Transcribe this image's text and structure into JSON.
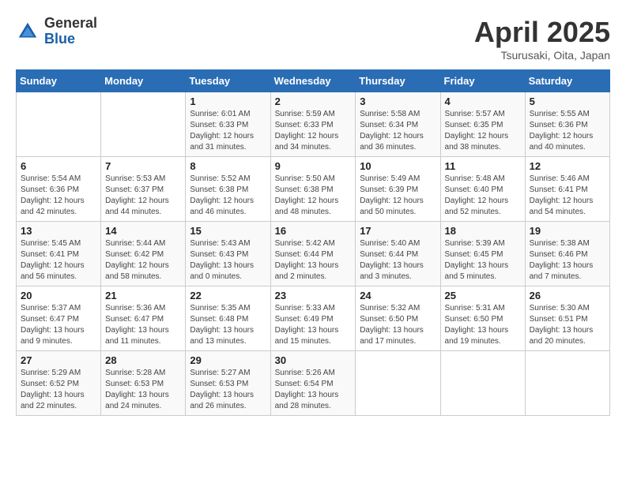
{
  "header": {
    "logo_general": "General",
    "logo_blue": "Blue",
    "title": "April 2025",
    "subtitle": "Tsurusaki, Oita, Japan"
  },
  "weekdays": [
    "Sunday",
    "Monday",
    "Tuesday",
    "Wednesday",
    "Thursday",
    "Friday",
    "Saturday"
  ],
  "weeks": [
    [
      {
        "day": "",
        "sunrise": "",
        "sunset": "",
        "daylight": ""
      },
      {
        "day": "",
        "sunrise": "",
        "sunset": "",
        "daylight": ""
      },
      {
        "day": "1",
        "sunrise": "Sunrise: 6:01 AM",
        "sunset": "Sunset: 6:33 PM",
        "daylight": "Daylight: 12 hours and 31 minutes."
      },
      {
        "day": "2",
        "sunrise": "Sunrise: 5:59 AM",
        "sunset": "Sunset: 6:33 PM",
        "daylight": "Daylight: 12 hours and 34 minutes."
      },
      {
        "day": "3",
        "sunrise": "Sunrise: 5:58 AM",
        "sunset": "Sunset: 6:34 PM",
        "daylight": "Daylight: 12 hours and 36 minutes."
      },
      {
        "day": "4",
        "sunrise": "Sunrise: 5:57 AM",
        "sunset": "Sunset: 6:35 PM",
        "daylight": "Daylight: 12 hours and 38 minutes."
      },
      {
        "day": "5",
        "sunrise": "Sunrise: 5:55 AM",
        "sunset": "Sunset: 6:36 PM",
        "daylight": "Daylight: 12 hours and 40 minutes."
      }
    ],
    [
      {
        "day": "6",
        "sunrise": "Sunrise: 5:54 AM",
        "sunset": "Sunset: 6:36 PM",
        "daylight": "Daylight: 12 hours and 42 minutes."
      },
      {
        "day": "7",
        "sunrise": "Sunrise: 5:53 AM",
        "sunset": "Sunset: 6:37 PM",
        "daylight": "Daylight: 12 hours and 44 minutes."
      },
      {
        "day": "8",
        "sunrise": "Sunrise: 5:52 AM",
        "sunset": "Sunset: 6:38 PM",
        "daylight": "Daylight: 12 hours and 46 minutes."
      },
      {
        "day": "9",
        "sunrise": "Sunrise: 5:50 AM",
        "sunset": "Sunset: 6:38 PM",
        "daylight": "Daylight: 12 hours and 48 minutes."
      },
      {
        "day": "10",
        "sunrise": "Sunrise: 5:49 AM",
        "sunset": "Sunset: 6:39 PM",
        "daylight": "Daylight: 12 hours and 50 minutes."
      },
      {
        "day": "11",
        "sunrise": "Sunrise: 5:48 AM",
        "sunset": "Sunset: 6:40 PM",
        "daylight": "Daylight: 12 hours and 52 minutes."
      },
      {
        "day": "12",
        "sunrise": "Sunrise: 5:46 AM",
        "sunset": "Sunset: 6:41 PM",
        "daylight": "Daylight: 12 hours and 54 minutes."
      }
    ],
    [
      {
        "day": "13",
        "sunrise": "Sunrise: 5:45 AM",
        "sunset": "Sunset: 6:41 PM",
        "daylight": "Daylight: 12 hours and 56 minutes."
      },
      {
        "day": "14",
        "sunrise": "Sunrise: 5:44 AM",
        "sunset": "Sunset: 6:42 PM",
        "daylight": "Daylight: 12 hours and 58 minutes."
      },
      {
        "day": "15",
        "sunrise": "Sunrise: 5:43 AM",
        "sunset": "Sunset: 6:43 PM",
        "daylight": "Daylight: 13 hours and 0 minutes."
      },
      {
        "day": "16",
        "sunrise": "Sunrise: 5:42 AM",
        "sunset": "Sunset: 6:44 PM",
        "daylight": "Daylight: 13 hours and 2 minutes."
      },
      {
        "day": "17",
        "sunrise": "Sunrise: 5:40 AM",
        "sunset": "Sunset: 6:44 PM",
        "daylight": "Daylight: 13 hours and 3 minutes."
      },
      {
        "day": "18",
        "sunrise": "Sunrise: 5:39 AM",
        "sunset": "Sunset: 6:45 PM",
        "daylight": "Daylight: 13 hours and 5 minutes."
      },
      {
        "day": "19",
        "sunrise": "Sunrise: 5:38 AM",
        "sunset": "Sunset: 6:46 PM",
        "daylight": "Daylight: 13 hours and 7 minutes."
      }
    ],
    [
      {
        "day": "20",
        "sunrise": "Sunrise: 5:37 AM",
        "sunset": "Sunset: 6:47 PM",
        "daylight": "Daylight: 13 hours and 9 minutes."
      },
      {
        "day": "21",
        "sunrise": "Sunrise: 5:36 AM",
        "sunset": "Sunset: 6:47 PM",
        "daylight": "Daylight: 13 hours and 11 minutes."
      },
      {
        "day": "22",
        "sunrise": "Sunrise: 5:35 AM",
        "sunset": "Sunset: 6:48 PM",
        "daylight": "Daylight: 13 hours and 13 minutes."
      },
      {
        "day": "23",
        "sunrise": "Sunrise: 5:33 AM",
        "sunset": "Sunset: 6:49 PM",
        "daylight": "Daylight: 13 hours and 15 minutes."
      },
      {
        "day": "24",
        "sunrise": "Sunrise: 5:32 AM",
        "sunset": "Sunset: 6:50 PM",
        "daylight": "Daylight: 13 hours and 17 minutes."
      },
      {
        "day": "25",
        "sunrise": "Sunrise: 5:31 AM",
        "sunset": "Sunset: 6:50 PM",
        "daylight": "Daylight: 13 hours and 19 minutes."
      },
      {
        "day": "26",
        "sunrise": "Sunrise: 5:30 AM",
        "sunset": "Sunset: 6:51 PM",
        "daylight": "Daylight: 13 hours and 20 minutes."
      }
    ],
    [
      {
        "day": "27",
        "sunrise": "Sunrise: 5:29 AM",
        "sunset": "Sunset: 6:52 PM",
        "daylight": "Daylight: 13 hours and 22 minutes."
      },
      {
        "day": "28",
        "sunrise": "Sunrise: 5:28 AM",
        "sunset": "Sunset: 6:53 PM",
        "daylight": "Daylight: 13 hours and 24 minutes."
      },
      {
        "day": "29",
        "sunrise": "Sunrise: 5:27 AM",
        "sunset": "Sunset: 6:53 PM",
        "daylight": "Daylight: 13 hours and 26 minutes."
      },
      {
        "day": "30",
        "sunrise": "Sunrise: 5:26 AM",
        "sunset": "Sunset: 6:54 PM",
        "daylight": "Daylight: 13 hours and 28 minutes."
      },
      {
        "day": "",
        "sunrise": "",
        "sunset": "",
        "daylight": ""
      },
      {
        "day": "",
        "sunrise": "",
        "sunset": "",
        "daylight": ""
      },
      {
        "day": "",
        "sunrise": "",
        "sunset": "",
        "daylight": ""
      }
    ]
  ]
}
